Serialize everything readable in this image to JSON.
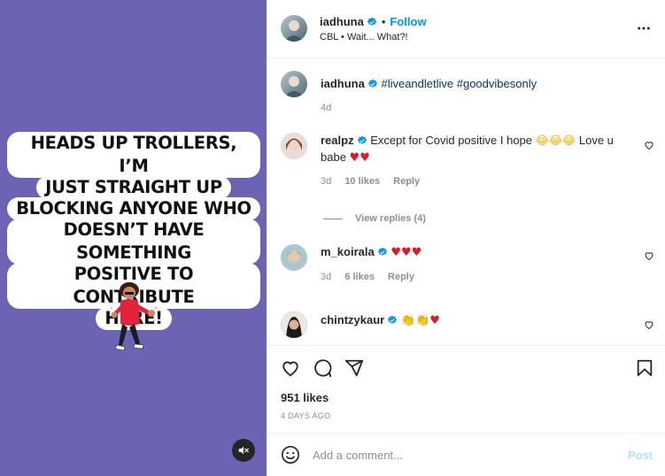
{
  "media": {
    "caption_lines": [
      "HEADS UP TROLLERS, I’M",
      "JUST STRAIGHT UP",
      "BLOCKING ANYONE WHO",
      "DOESN’T HAVE SOMETHING",
      "POSITIVE TO CONTRIBUTE",
      "HERE!"
    ],
    "background_color": "#6c63b5",
    "mute_icon": "speaker-muted-icon"
  },
  "header": {
    "username": "iadhuna",
    "separator": "•",
    "follow_label": "Follow",
    "subtitle": "CBL • Wait... What?!"
  },
  "caption_comment": {
    "username": "iadhuna",
    "text": "#liveandletlive #goodvibesonly",
    "time": "4d"
  },
  "comments": [
    {
      "username": "realpz",
      "text": "Except for Covid positive I hope",
      "text_after": "Love u babe",
      "time": "3d",
      "likes": "10 likes",
      "reply_label": "Reply"
    },
    {
      "username": "m_koirala",
      "time": "3d",
      "likes": "6 likes",
      "reply_label": "Reply"
    },
    {
      "username": "chintzykaur"
    }
  ],
  "view_replies": "View replies (4)",
  "actions": {
    "likes": "951 likes",
    "posted_ago": "4 DAYS AGO"
  },
  "add_comment": {
    "placeholder": "Add a comment...",
    "post_label": "Post"
  },
  "colors": {
    "accent": "#0095f6",
    "hashtag": "#00376b",
    "heart": "#e0162b"
  }
}
